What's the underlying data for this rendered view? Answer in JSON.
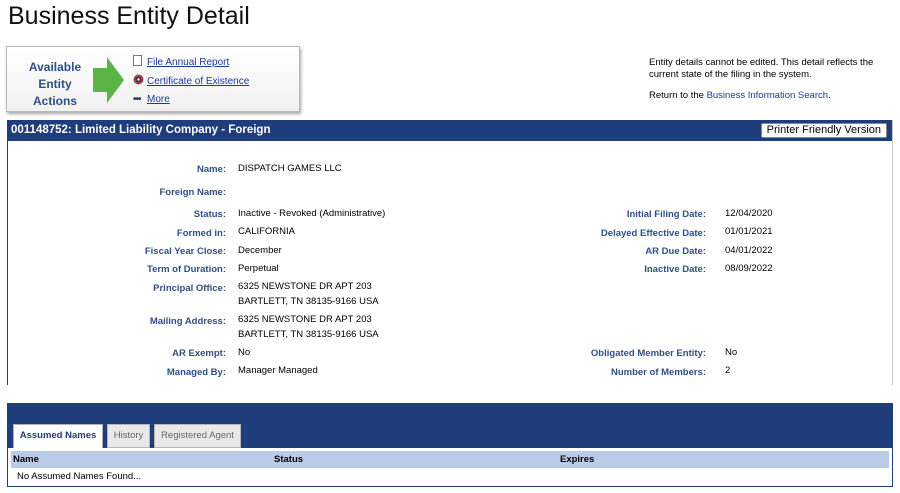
{
  "page": {
    "title": "Business Entity Detail"
  },
  "actions": {
    "title_lines": [
      "Available",
      "Entity",
      "Actions"
    ],
    "links": [
      {
        "label": "File Annual Report",
        "icon": "document-icon"
      },
      {
        "label": "Certificate of Existence",
        "icon": "seal-icon"
      },
      {
        "label": "More",
        "icon": "more-dots-icon"
      }
    ]
  },
  "notice": {
    "text": "Entity details cannot be edited. This detail reflects the current state of the filing in the system.",
    "return_prefix": "Return to the ",
    "return_link": "Business Information Search",
    "return_suffix": "."
  },
  "entity": {
    "header": "001148752: Limited Liability Company - Foreign",
    "printer_button": "Printer Friendly Version",
    "left_fields": [
      {
        "label": "Name:",
        "value": "DISPATCH GAMES LLC"
      },
      {
        "label": "Foreign Name:",
        "value": ""
      },
      {
        "label": "Status:",
        "value": "Inactive - Revoked (Administrative)"
      },
      {
        "label": "Formed in:",
        "value": "CALIFORNIA"
      },
      {
        "label": "Fiscal Year Close:",
        "value": "December"
      },
      {
        "label": "Term of Duration:",
        "value": "Perpetual"
      },
      {
        "label": "Principal Office:",
        "value": "6325 NEWSTONE DR APT 203",
        "value2": "BARTLETT, TN 38135-9166 USA"
      },
      {
        "label": "Mailing Address:",
        "value": "6325 NEWSTONE DR APT 203",
        "value2": "BARTLETT, TN 38135-9166 USA"
      },
      {
        "label": "AR Exempt:",
        "value": "No"
      },
      {
        "label": "Managed By:",
        "value": "Manager Managed"
      }
    ],
    "right_fields": [
      {
        "label": "Initial Filing Date:",
        "value": "12/04/2020"
      },
      {
        "label": "Delayed Effective Date:",
        "value": "01/01/2021"
      },
      {
        "label": "AR Due Date:",
        "value": "04/01/2022"
      },
      {
        "label": "Inactive Date:",
        "value": "08/09/2022"
      },
      {
        "label": "Obligated Member Entity:",
        "value": "No"
      },
      {
        "label": "Number of Members:",
        "value": "2"
      }
    ]
  },
  "tabs": [
    {
      "label": "Assumed Names",
      "active": true
    },
    {
      "label": "History",
      "active": false
    },
    {
      "label": "Registered Agent",
      "active": false
    }
  ],
  "assumed_names": {
    "columns": [
      "Name",
      "Status",
      "Expires"
    ],
    "empty_message": "No Assumed Names Found..."
  },
  "colors": {
    "header_bar": "#1f3d7a",
    "label_text": "#2f4f86",
    "link": "#1a3a9c",
    "arrow": "#5ab546",
    "column_header": "#b9cbe6"
  }
}
